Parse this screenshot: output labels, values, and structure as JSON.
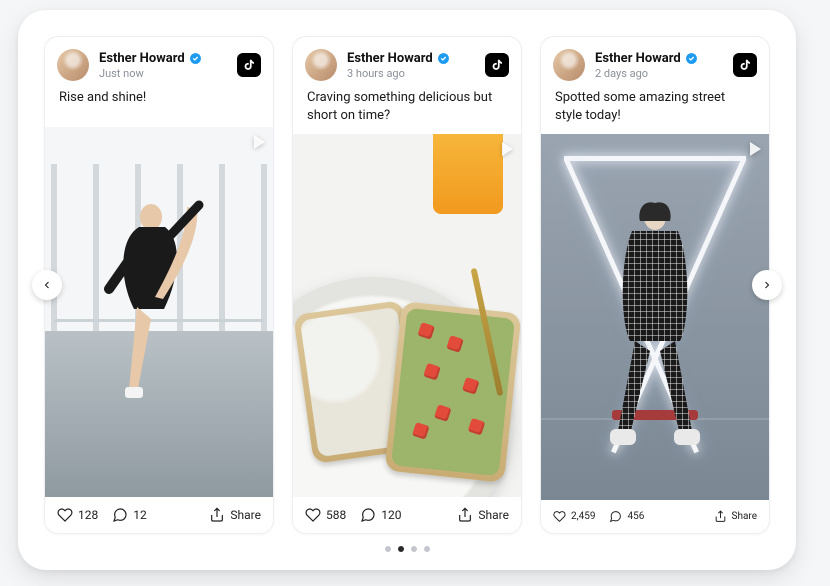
{
  "user": {
    "name": "Esther Howard",
    "verified": true,
    "platform": "tiktok"
  },
  "share_label": "Share",
  "posts": [
    {
      "timestamp": "Just now",
      "caption": "Rise and shine!",
      "likes": "128",
      "comments": "12",
      "size": "normal"
    },
    {
      "timestamp": "3 hours ago",
      "caption": "Craving something delicious but short on time?",
      "likes": "588",
      "comments": "120",
      "size": "normal"
    },
    {
      "timestamp": "2 days ago",
      "caption": "Spotted some amazing street style today!",
      "likes": "2,459",
      "comments": "456",
      "size": "small"
    }
  ],
  "pagination": {
    "total": 4,
    "active_index": 1
  }
}
